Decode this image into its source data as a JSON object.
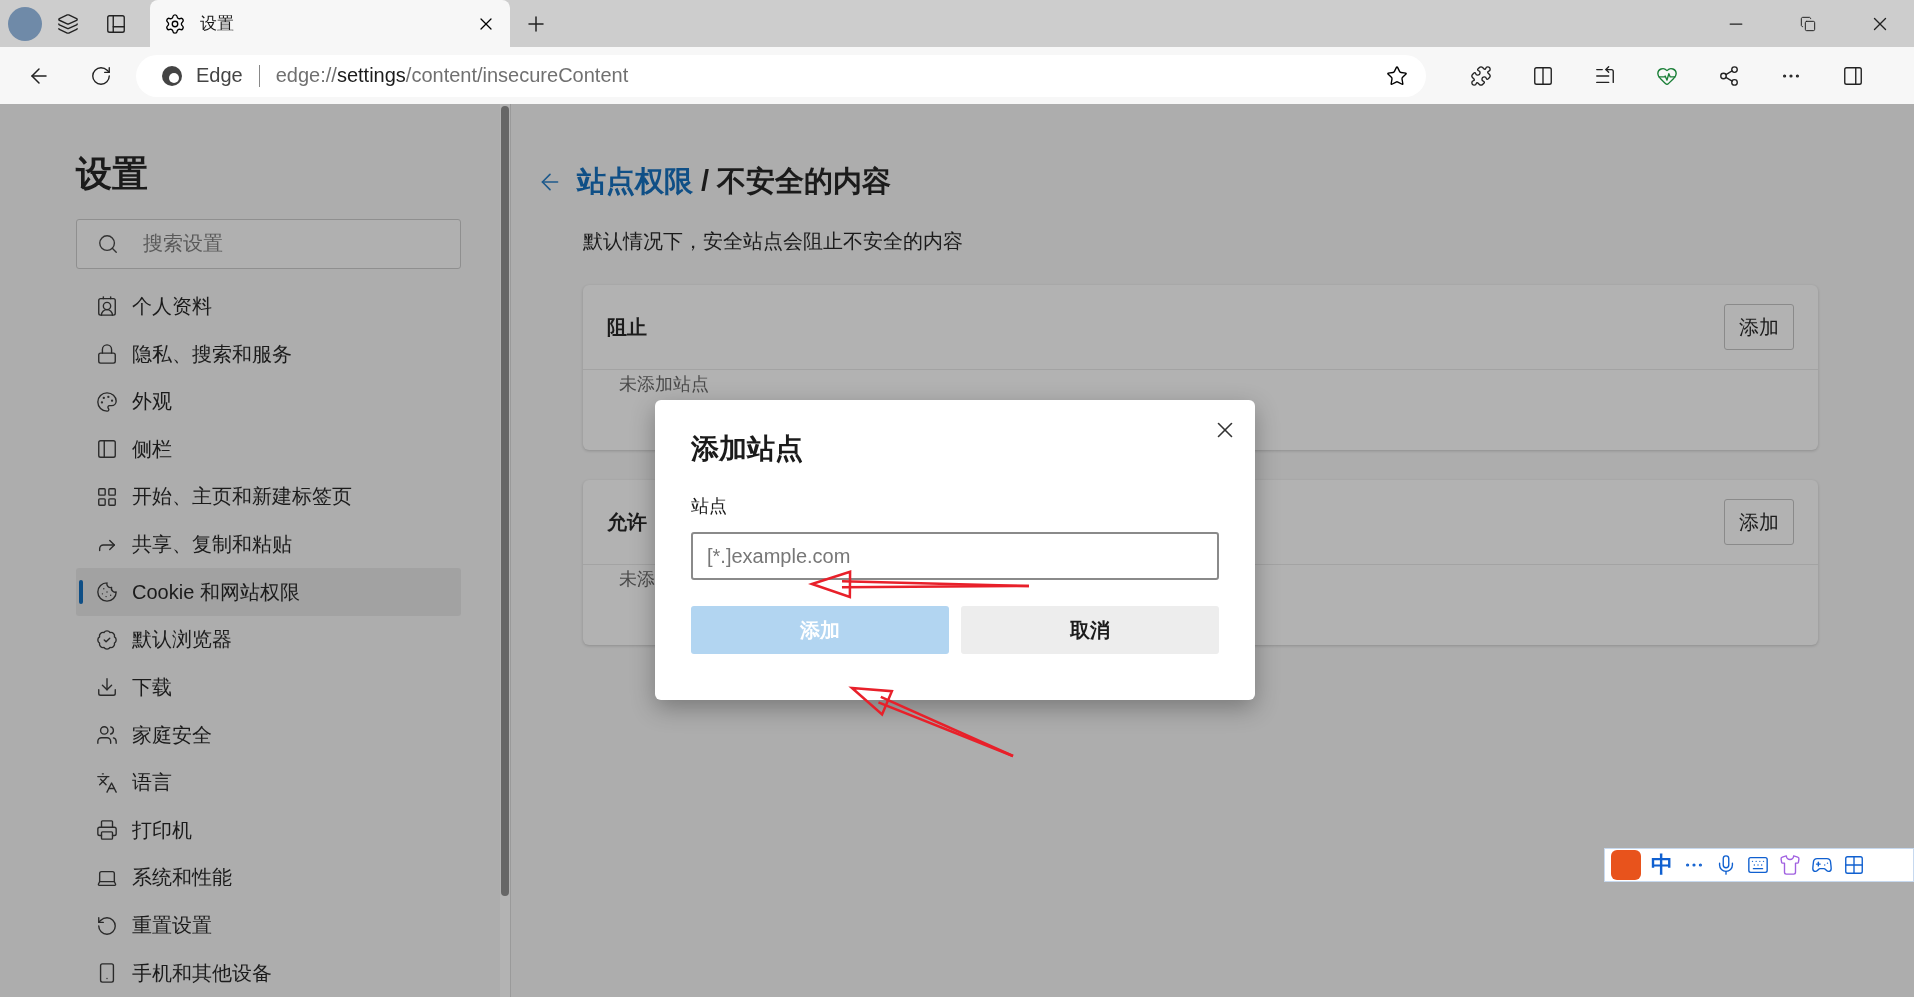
{
  "browser": {
    "tabs": [
      {
        "title": "设置",
        "selected": true
      }
    ],
    "address": {
      "brand": "Edge",
      "url": "edge://**settings**/content/insecureContent"
    }
  },
  "sidebar": {
    "title": "设置",
    "search": {
      "placeholder": "搜索设置"
    },
    "items": [
      {
        "label": "个人资料",
        "selected": false
      },
      {
        "label": "隐私、搜索和服务",
        "selected": false
      },
      {
        "label": "外观",
        "selected": false
      },
      {
        "label": "侧栏",
        "selected": false
      },
      {
        "label": "开始、主页和新建标签页",
        "selected": false
      },
      {
        "label": "共享、复制和粘贴",
        "selected": false
      },
      {
        "label": "Cookie 和网站权限",
        "selected": true
      },
      {
        "label": "默认浏览器",
        "selected": false
      },
      {
        "label": "下载",
        "selected": false
      },
      {
        "label": "家庭安全",
        "selected": false
      },
      {
        "label": "语言",
        "selected": false
      },
      {
        "label": "打印机",
        "selected": false
      },
      {
        "label": "系统和性能",
        "selected": false
      },
      {
        "label": "重置设置",
        "selected": false
      },
      {
        "label": "手机和其他设备",
        "selected": false
      }
    ]
  },
  "main": {
    "breadcrumb": {
      "parent": "站点权限",
      "current": "/ 不安全的内容"
    },
    "description": "默认情况下，安全站点会阻止不安全的内容",
    "sections": [
      {
        "title": "阻止",
        "button": "添加",
        "empty": "未添加站点"
      },
      {
        "title": "允许",
        "button": "添加",
        "empty": "未添"
      }
    ]
  },
  "dialog": {
    "title": "添加站点",
    "field_label": "站点",
    "placeholder": "[*.]example.com",
    "buttons": [
      {
        "label": "添加",
        "kind": "primary",
        "disabled": true
      },
      {
        "label": "取消",
        "kind": "secondary",
        "disabled": false
      }
    ]
  },
  "ime_toolbar": {
    "mode": "中"
  }
}
